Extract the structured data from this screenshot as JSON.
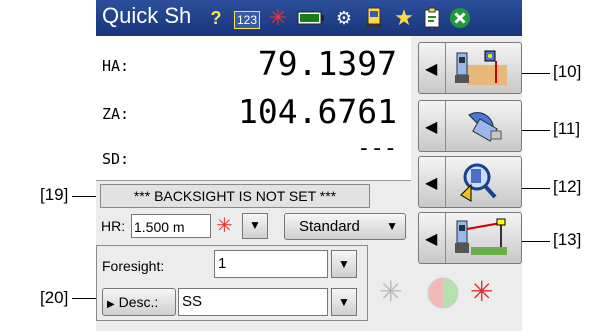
{
  "app": {
    "title": "Quick Sh"
  },
  "titlebar": {
    "icons": [
      "help-icon",
      "numeric-123-icon",
      "laser-icon",
      "battery-icon",
      "settings-gear-icon",
      "instrument-icon",
      "favorites-star-icon",
      "clipboard-icon",
      "close-icon"
    ],
    "num_icon_text": "123"
  },
  "readings": [
    {
      "label": "HA:",
      "value": "79.1397"
    },
    {
      "label": "ZA:",
      "value": "104.6761"
    },
    {
      "label": "SD:",
      "value": "---"
    }
  ],
  "right_buttons": [
    {
      "callout": "[10]",
      "icon": "instrument-on-site-icon"
    },
    {
      "callout": "[11]",
      "icon": "satellite-dish-icon"
    },
    {
      "callout": "[12]",
      "icon": "search-instrument-icon"
    },
    {
      "callout": "[13]",
      "icon": "instrument-to-target-icon"
    }
  ],
  "banner": {
    "text": "*** BACKSIGHT IS NOT SET ***",
    "callout": "[19]"
  },
  "hr": {
    "label": "HR:",
    "value": "1.500 m"
  },
  "mode": {
    "label": "Standard"
  },
  "foresight": {
    "label": "Foresight:",
    "value": "1",
    "callout": "[20]"
  },
  "desc": {
    "button_label": "Desc.:",
    "value": "SS"
  },
  "colors": {
    "titlebar": "#1f3f8a",
    "laser_red": "#e03030",
    "accent_green": "#8fd18a"
  }
}
